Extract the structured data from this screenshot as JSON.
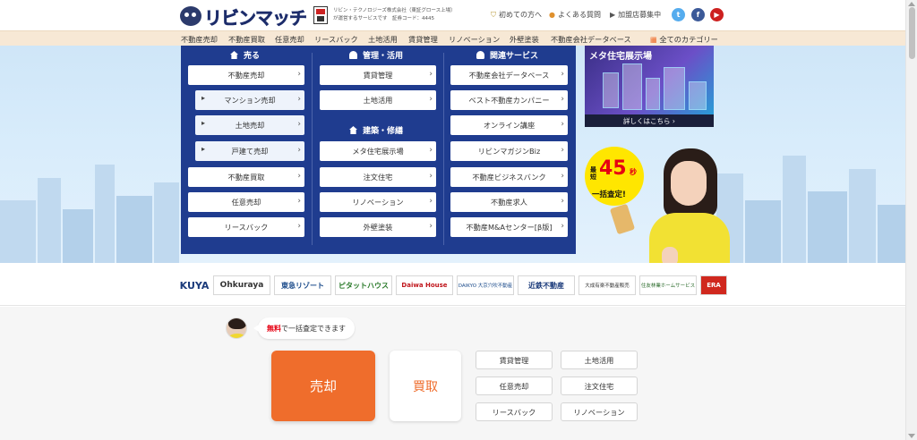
{
  "header": {
    "logo_text": "リビンマッチ",
    "corp_info_line1": "リビン・テクノロジーズ株式会社（東証グロース上場）",
    "corp_info_line2": "が運営するサービスです　証券コード：4445",
    "links": [
      {
        "icon": "shield-icon",
        "label": "初めての方へ"
      },
      {
        "icon": "question-icon",
        "label": "よくある質問"
      },
      {
        "icon": "flag-icon",
        "label": "加盟店募集中"
      }
    ],
    "social": [
      {
        "name": "twitter-icon",
        "glyph": "t",
        "color": "#55acee"
      },
      {
        "name": "facebook-icon",
        "glyph": "f",
        "color": "#3b5998"
      },
      {
        "name": "youtube-icon",
        "glyph": "▶",
        "color": "#cd201f"
      }
    ]
  },
  "categories": {
    "items": [
      "不動産売却",
      "不動産買取",
      "任意売却",
      "リースバック",
      "土地活用",
      "賃貸管理",
      "リノベーション",
      "外壁塗装",
      "不動産会社データベース"
    ],
    "all_label": "全てのカテゴリー",
    "all_icon": "grid-icon"
  },
  "megamenu": {
    "col1": {
      "title": "売る",
      "items": [
        {
          "label": "不動産売却",
          "sub": false
        },
        {
          "label": "マンション売却",
          "sub": true
        },
        {
          "label": "土地売却",
          "sub": true
        },
        {
          "label": "戸建て売却",
          "sub": true
        },
        {
          "label": "不動産買取",
          "sub": false
        },
        {
          "label": "任意売却",
          "sub": false
        },
        {
          "label": "リースバック",
          "sub": false
        }
      ]
    },
    "col2": {
      "title": "管理・活用",
      "items": [
        "賃貸管理",
        "土地活用"
      ],
      "title2": "建築・修繕",
      "items2": [
        "メタ住宅展示場",
        "注文住宅",
        "リノベーション",
        "外壁塗装"
      ]
    },
    "col3": {
      "title": "関連サービス",
      "items": [
        "不動産会社データベース",
        "ベスト不動産カンパニー",
        "オンライン講座",
        "リビンマガジンBiz",
        "不動産ビジネスバンク",
        "不動産求人",
        "不動産M&Aセンター[β版]"
      ]
    }
  },
  "meta_banner": {
    "title": "メタ住宅展示場",
    "button": "詳しくはこちら ›"
  },
  "promo": {
    "small_label": "最短",
    "number": "45",
    "unit": "秒",
    "cta": "一括査定!"
  },
  "partner_logos": [
    "KUYA",
    "Ohkuraya",
    "東急リゾート",
    "ピタットハウス",
    "Daiwa House",
    "DAIKYO 大京穴吹不動産",
    "近鉄不動産",
    "大成有楽不動産販売",
    "住友林業ホームサービス",
    "ERA"
  ],
  "lower": {
    "bubble_free": "無料",
    "bubble_text": "で一括査定できます",
    "sell_label": "売却",
    "buy_label": "買取",
    "quick_buttons": [
      "賃貸管理",
      "土地活用",
      "任意売却",
      "注文住宅",
      "リースバック",
      "リノベーション"
    ]
  },
  "colors": {
    "navy": "#1f3c8f",
    "orange": "#ef6d2c",
    "category_bar": "#f7e8d5"
  }
}
